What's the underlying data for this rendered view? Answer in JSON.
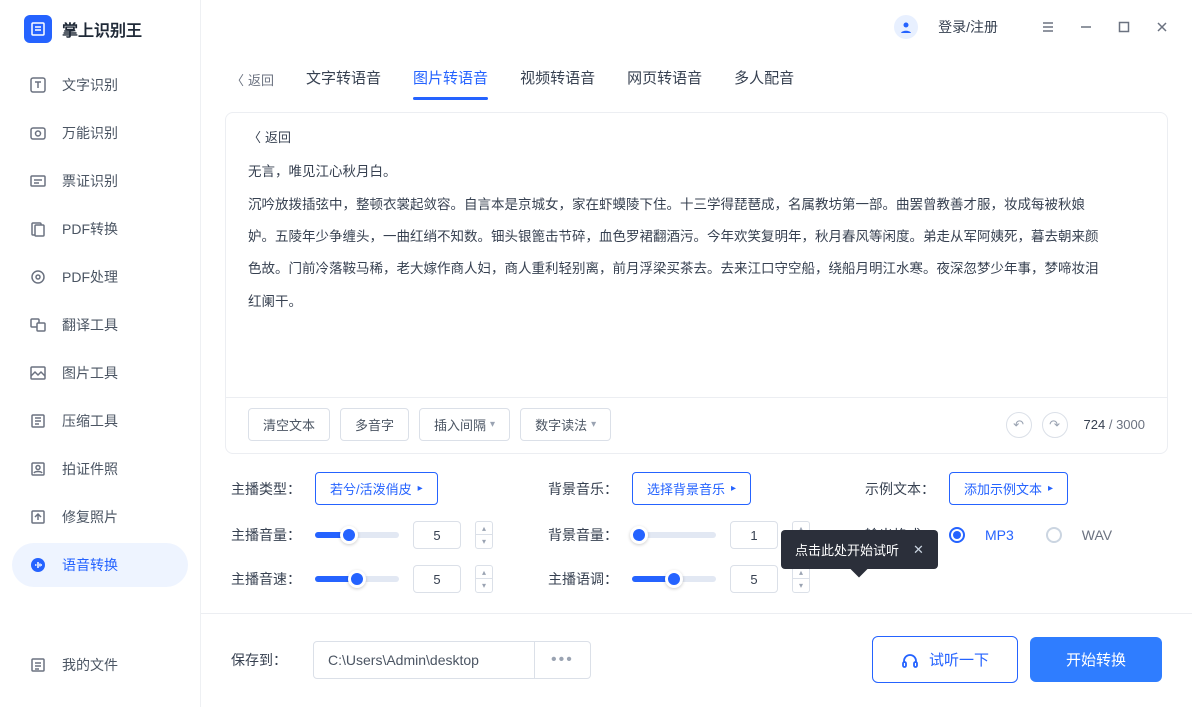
{
  "app": {
    "name": "掌上识别王"
  },
  "header": {
    "login": "登录/注册"
  },
  "sidebar": {
    "items": [
      {
        "label": "文字识别"
      },
      {
        "label": "万能识别"
      },
      {
        "label": "票证识别"
      },
      {
        "label": "PDF转换"
      },
      {
        "label": "PDF处理"
      },
      {
        "label": "翻译工具"
      },
      {
        "label": "图片工具"
      },
      {
        "label": "压缩工具"
      },
      {
        "label": "拍证件照"
      },
      {
        "label": "修复照片"
      },
      {
        "label": "语音转换"
      }
    ],
    "bottom": {
      "label": "我的文件"
    }
  },
  "tabs": {
    "back": "返回",
    "items": [
      {
        "label": "文字转语音"
      },
      {
        "label": "图片转语音"
      },
      {
        "label": "视频转语音"
      },
      {
        "label": "网页转语音"
      },
      {
        "label": "多人配音"
      }
    ],
    "active_index": 1
  },
  "content": {
    "sub_back": "返回",
    "lines": [
      "无言，唯见江心秋月白。",
      "沉吟放拨插弦中，整顿衣裳起敛容。自言本是京城女，家在虾蟆陵下住。十三学得琵琶成，名属教坊第一部。曲罢曾教善才服，妆成每被秋娘",
      "妒。五陵年少争缠头，一曲红绡不知数。钿头银篦击节碎，血色罗裙翻酒污。今年欢笑复明年，秋月春风等闲度。弟走从军阿姨死，暮去朝来颜",
      "色故。门前冷落鞍马稀，老大嫁作商人妇，商人重利轻别离，前月浮梁买茶去。去来江口守空船，绕船月明江水寒。夜深忽梦少年事，梦啼妆泪",
      "红阑干。"
    ]
  },
  "toolbar": {
    "clear": "清空文本",
    "polyphone": "多音字",
    "insert_interval": "插入间隔",
    "number_reading": "数字读法",
    "count_current": "724",
    "count_max": "3000"
  },
  "opts": {
    "anchor_type_label": "主播类型：",
    "anchor_type_value": "若兮/活泼俏皮",
    "bg_music_label": "背景音乐：",
    "bg_music_value": "选择背景音乐",
    "sample_label": "示例文本：",
    "sample_value": "添加示例文本",
    "anchor_volume_label": "主播音量：",
    "anchor_volume_value": "5",
    "bg_volume_label": "背景音量：",
    "bg_volume_value": "1",
    "format_label": "输出格式：",
    "format_mp3": "MP3",
    "format_wav": "WAV",
    "anchor_speed_label": "主播音速：",
    "anchor_speed_value": "5",
    "anchor_tone_label": "主播语调：",
    "anchor_tone_value": "5",
    "tooltip": "点击此处开始试听"
  },
  "footer": {
    "save_label": "保存到：",
    "path": "C:\\Users\\Admin\\desktop",
    "preview": "试听一下",
    "start": "开始转换"
  }
}
